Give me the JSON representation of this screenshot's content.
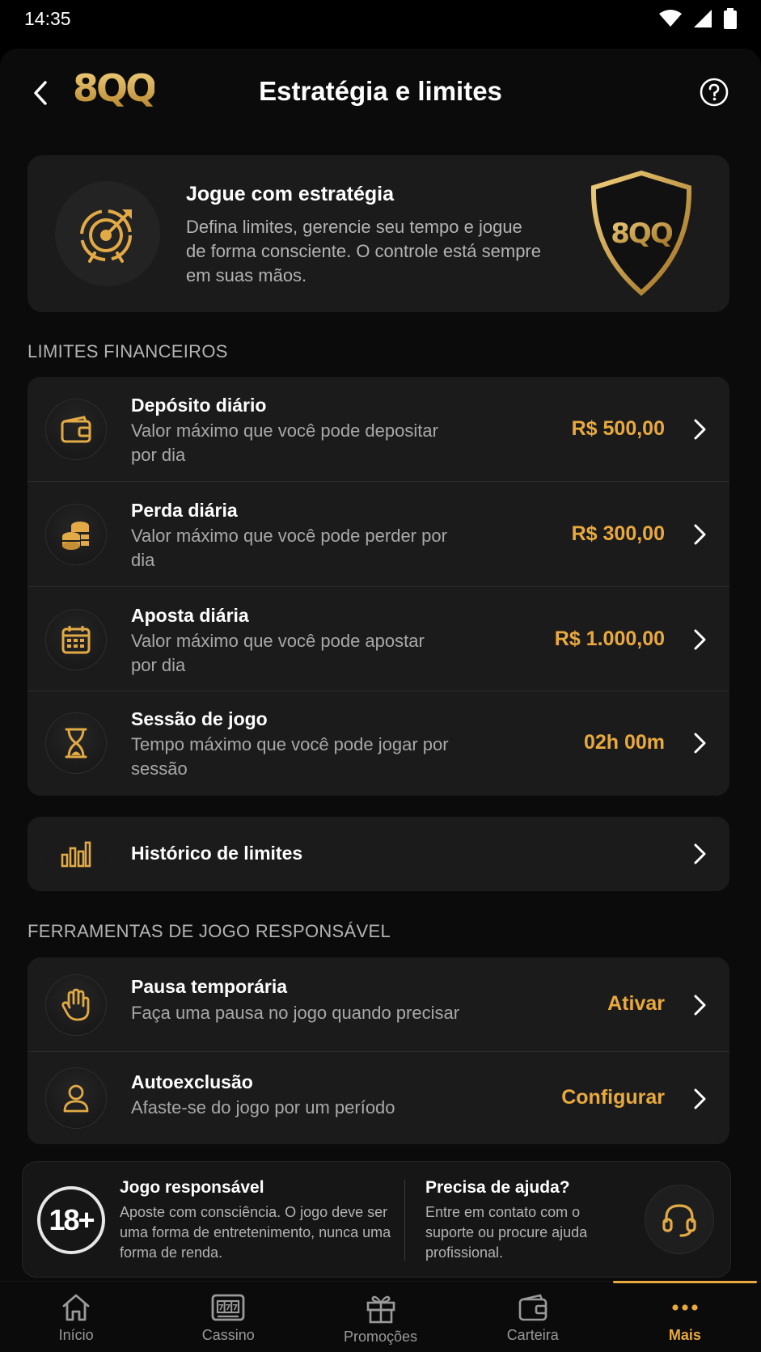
{
  "status_bar": {
    "time": "14:35"
  },
  "header": {
    "logo": "8QQ",
    "title": "Estratégia e limites"
  },
  "hero": {
    "title": "Jogue com estratégia",
    "text": "Defina limites, gerencie seu tempo e jogue de forma consciente. O controle está sempre em suas mãos.",
    "shield_logo": "8QQ"
  },
  "financial": {
    "label": "LIMITES FINANCEIROS",
    "items": [
      {
        "icon": "wallet-icon",
        "title": "Depósito diário",
        "desc": "Valor máximo que você pode depositar por dia",
        "value": "R$ 500,00"
      },
      {
        "icon": "coins-icon",
        "title": "Perda diária",
        "desc": "Valor máximo que você pode perder por dia",
        "value": "R$ 300,00"
      },
      {
        "icon": "calendar-icon",
        "title": "Aposta diária",
        "desc": "Valor máximo que você pode apostar por dia",
        "value": "R$ 1.000,00"
      },
      {
        "icon": "hourglass-icon",
        "title": "Sessão de jogo",
        "desc": "Tempo máximo que você pode jogar por sessão",
        "value": "02h 00m"
      }
    ]
  },
  "history": {
    "icon": "bar-chart-icon",
    "title": "Histórico de limites"
  },
  "tools": {
    "label": "FERRAMENTAS DE JOGO RESPONSÁVEL",
    "items": [
      {
        "icon": "hand-icon",
        "title": "Pausa temporária",
        "desc": "Faça uma pausa no jogo quando precisar",
        "value": "Ativar"
      },
      {
        "icon": "user-icon",
        "title": "Autoexclusão",
        "desc": "Afaste-se do jogo por um período",
        "value": "Configurar"
      }
    ]
  },
  "footer": {
    "age_badge": "18+",
    "responsible_title": "Jogo responsável",
    "responsible_text": "Aposte com consciência. O jogo deve ser uma forma de entretenimento, nunca uma forma de renda.",
    "help_title": "Precisa de ajuda?",
    "help_text": "Entre em contato com o suporte ou procure ajuda profissional."
  },
  "nav": {
    "items": [
      {
        "icon": "home-icon",
        "label": "Início"
      },
      {
        "icon": "slot-machine-icon",
        "label": "Cassino"
      },
      {
        "icon": "gift-icon",
        "label": "Promoções"
      },
      {
        "icon": "wallet-icon",
        "label": "Carteira"
      },
      {
        "icon": "more-icon",
        "label": "Mais",
        "active": true
      }
    ]
  },
  "colors": {
    "accent": "#e9a93d",
    "card": "#1b1b1b",
    "background": "#0b0b0b"
  }
}
